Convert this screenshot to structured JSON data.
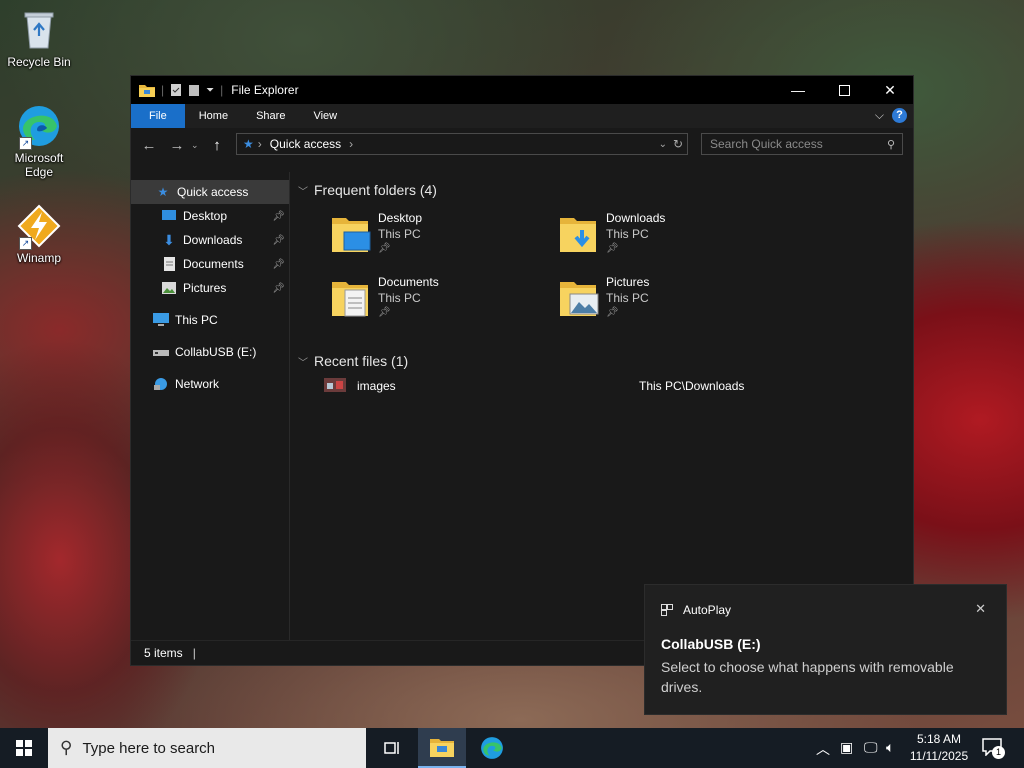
{
  "desktop": {
    "icons": [
      {
        "label": "Recycle Bin",
        "icon": "recycle-bin-icon"
      },
      {
        "label": "Microsoft Edge",
        "icon": "edge-icon"
      },
      {
        "label": "Winamp",
        "icon": "winamp-icon"
      }
    ]
  },
  "window": {
    "title": "File Explorer",
    "ribbon_tabs": [
      "File",
      "Home",
      "Share",
      "View"
    ],
    "address": {
      "path": "Quick access"
    },
    "search": {
      "placeholder": "Search Quick access"
    },
    "nav_pane": {
      "items": [
        {
          "label": "Quick access",
          "icon": "star-icon",
          "selected": true
        },
        {
          "label": "Desktop",
          "icon": "desktop-icon",
          "pinned": true
        },
        {
          "label": "Downloads",
          "icon": "download-arrow-icon",
          "pinned": true
        },
        {
          "label": "Documents",
          "icon": "document-icon",
          "pinned": true
        },
        {
          "label": "Pictures",
          "icon": "pictures-icon",
          "pinned": true
        },
        {
          "label": "This PC",
          "icon": "computer-icon"
        },
        {
          "label": "CollabUSB (E:)",
          "icon": "usb-drive-icon"
        },
        {
          "label": "Network",
          "icon": "network-icon"
        }
      ]
    },
    "frequent_folders": {
      "heading": "Frequent folders (4)",
      "items": [
        {
          "name": "Desktop",
          "location": "This PC"
        },
        {
          "name": "Downloads",
          "location": "This PC"
        },
        {
          "name": "Documents",
          "location": "This PC"
        },
        {
          "name": "Pictures",
          "location": "This PC"
        }
      ]
    },
    "recent_files": {
      "heading": "Recent files (1)",
      "items": [
        {
          "name": "images",
          "path": "This PC\\Downloads"
        }
      ]
    },
    "status": {
      "items_count": "5 items"
    }
  },
  "toast": {
    "app": "AutoPlay",
    "title": "CollabUSB (E:)",
    "message": "Select to choose what happens with removable drives."
  },
  "taskbar": {
    "search_placeholder": "Type here to search",
    "clock": {
      "time": "5:18 AM",
      "date": "11/11/2025"
    },
    "notification_count": "1"
  },
  "colors": {
    "accent": "#1a6fc9",
    "window_bg": "#191919",
    "taskbar_bg": "#151c24"
  }
}
